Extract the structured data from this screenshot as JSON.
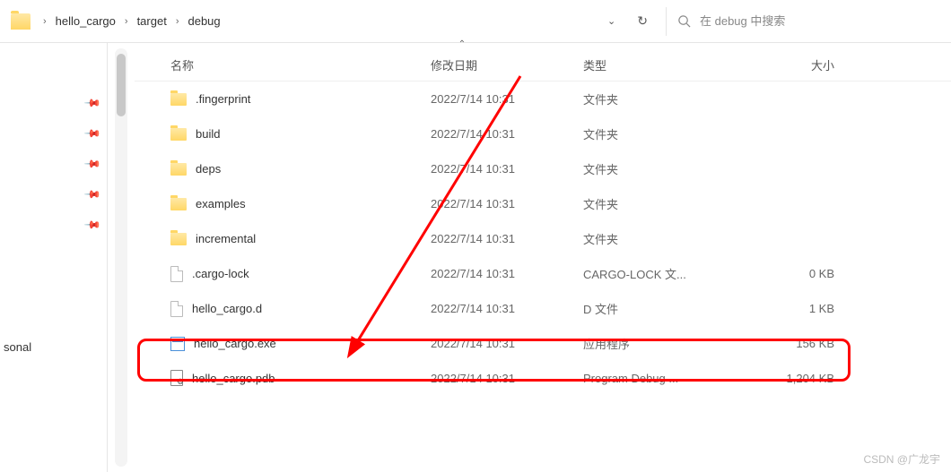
{
  "breadcrumb": {
    "items": [
      "hello_cargo",
      "target",
      "debug"
    ]
  },
  "search": {
    "placeholder": "在 debug 中搜索"
  },
  "columns": {
    "name": "名称",
    "date": "修改日期",
    "type": "类型",
    "size": "大小"
  },
  "sidebar": {
    "truncated_label": "sonal"
  },
  "files": [
    {
      "icon": "folder",
      "name": ".fingerprint",
      "date": "2022/7/14 10:31",
      "type": "文件夹",
      "size": ""
    },
    {
      "icon": "folder",
      "name": "build",
      "date": "2022/7/14 10:31",
      "type": "文件夹",
      "size": ""
    },
    {
      "icon": "folder",
      "name": "deps",
      "date": "2022/7/14 10:31",
      "type": "文件夹",
      "size": ""
    },
    {
      "icon": "folder",
      "name": "examples",
      "date": "2022/7/14 10:31",
      "type": "文件夹",
      "size": ""
    },
    {
      "icon": "folder",
      "name": "incremental",
      "date": "2022/7/14 10:31",
      "type": "文件夹",
      "size": ""
    },
    {
      "icon": "file",
      "name": ".cargo-lock",
      "date": "2022/7/14 10:31",
      "type": "CARGO-LOCK 文...",
      "size": "0 KB"
    },
    {
      "icon": "file",
      "name": "hello_cargo.d",
      "date": "2022/7/14 10:31",
      "type": "D 文件",
      "size": "1 KB"
    },
    {
      "icon": "exe",
      "name": "hello_cargo.exe",
      "date": "2022/7/14 10:31",
      "type": "应用程序",
      "size": "156 KB"
    },
    {
      "icon": "pdb",
      "name": "hello_cargo.pdb",
      "date": "2022/7/14 10:31",
      "type": "Program Debug ...",
      "size": "1,204 KB"
    }
  ],
  "watermark": "CSDN @广龙宇"
}
